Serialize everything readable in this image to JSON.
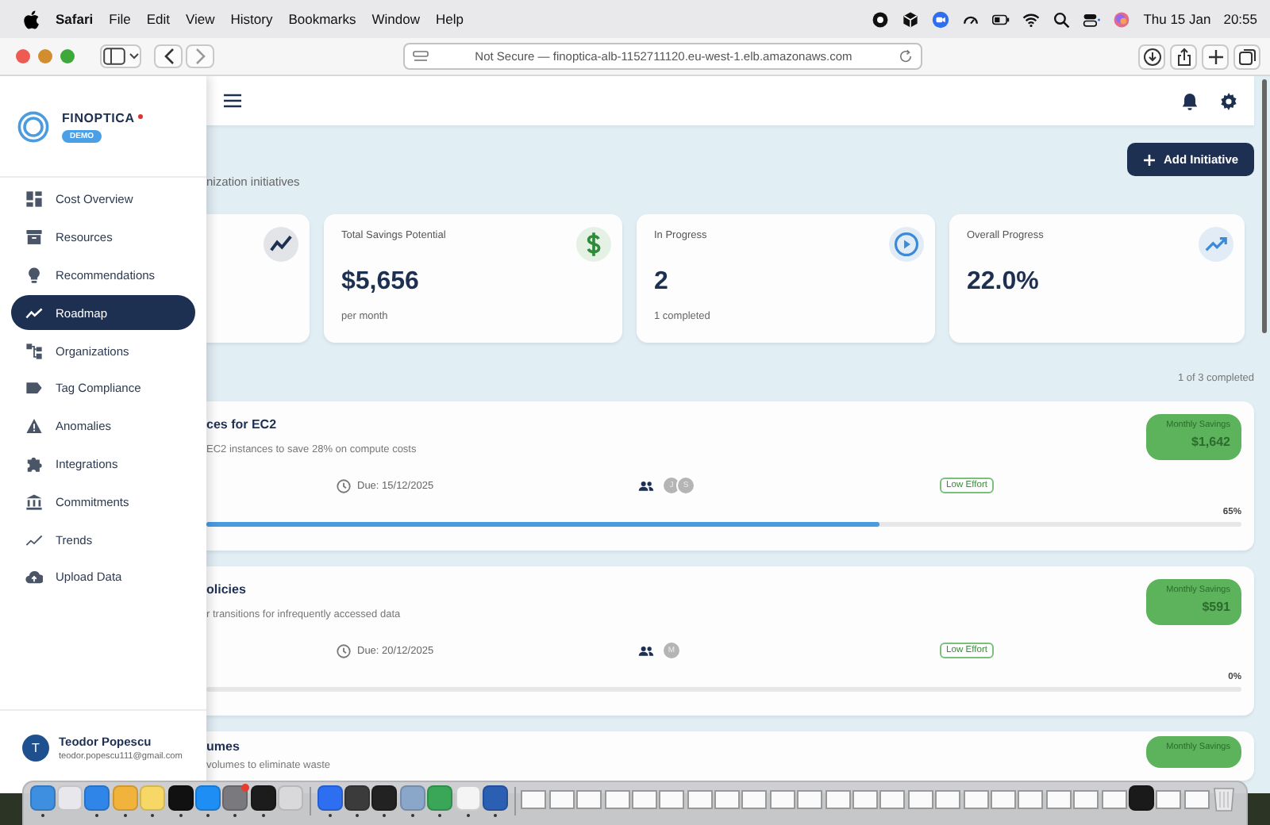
{
  "menu_bar": {
    "app": "Safari",
    "menus": [
      "File",
      "Edit",
      "View",
      "History",
      "Bookmarks",
      "Window",
      "Help"
    ],
    "date": "Thu 15 Jan",
    "time": "20:55"
  },
  "browser": {
    "address": "Not Secure — finoptica-alb-1152711120.eu-west-1.elb.amazonaws.com"
  },
  "sidebar": {
    "brand": "FINOPTICA",
    "badge": "DEMO",
    "items": [
      {
        "label": "Cost Overview",
        "selected": false
      },
      {
        "label": "Resources",
        "selected": false
      },
      {
        "label": "Recommendations",
        "selected": false
      },
      {
        "label": "Roadmap",
        "selected": true
      },
      {
        "label": "Organizations",
        "selected": false
      },
      {
        "label": "Tag Compliance",
        "selected": false
      },
      {
        "label": "Anomalies",
        "selected": false
      },
      {
        "label": "Integrations",
        "selected": false
      },
      {
        "label": "Commitments",
        "selected": false
      },
      {
        "label": "Trends",
        "selected": false
      },
      {
        "label": "Upload Data",
        "selected": false
      }
    ],
    "user": {
      "initial": "T",
      "name": "Teodor Popescu",
      "email": "teodor.popescu111@gmail.com"
    }
  },
  "header": {
    "subtitle": "nization initiatives",
    "button": "Add Initiative"
  },
  "stats": [
    {
      "kind": "trend"
    },
    {
      "kind": "savings",
      "label": "Total Savings Potential",
      "value": "$5,656",
      "note": "per month"
    },
    {
      "kind": "progress",
      "label": "In Progress",
      "value": "2",
      "note": "1 completed"
    },
    {
      "kind": "overall",
      "label": "Overall Progress",
      "value": "22.0%"
    }
  ],
  "summary": "1 of 3 completed",
  "initiatives": [
    {
      "title": "ces for EC2",
      "description": "EC2 instances to save 28% on compute costs",
      "due": "Due: 15/12/2025",
      "owners": [
        "J",
        "S"
      ],
      "effort": "Low Effort",
      "savings_label": "Monthly Savings",
      "savings": "$1,642",
      "percent": "65%",
      "level": 0.65
    },
    {
      "title": "olicies",
      "description": "r transitions for infrequently accessed data",
      "due": "Due: 20/12/2025",
      "owners": [
        "M"
      ],
      "effort": "Low Effort",
      "savings_label": "Monthly Savings",
      "savings": "$591",
      "percent": "0%",
      "level": 0
    },
    {
      "title": "umes",
      "description": "volumes to eliminate waste",
      "savings_label": "Monthly Savings"
    }
  ],
  "dock": [
    {
      "kind": "app",
      "color": "#3f8fe0",
      "running": true
    },
    {
      "kind": "app",
      "color": "#e8e8ec",
      "running": false
    },
    {
      "kind": "app",
      "color": "#2f86e8",
      "running": true
    },
    {
      "kind": "app",
      "color": "#f2b33d",
      "running": true
    },
    {
      "kind": "app",
      "color": "#f7d766",
      "running": true
    },
    {
      "kind": "app",
      "color": "#111111",
      "running": true
    },
    {
      "kind": "app",
      "color": "#1e8ef5",
      "running": true
    },
    {
      "kind": "app",
      "color": "#7a7a7e",
      "running": true,
      "badge": true
    },
    {
      "kind": "app",
      "color": "#1c1c1c",
      "running": true
    },
    {
      "kind": "app",
      "color": "#d9d9dc",
      "running": false
    },
    {
      "kind": "separator"
    },
    {
      "kind": "app",
      "color": "#2d6ff0",
      "running": true
    },
    {
      "kind": "app",
      "color": "#3b3b3b",
      "running": true
    },
    {
      "kind": "app",
      "color": "#222222",
      "running": true
    },
    {
      "kind": "app",
      "color": "#8aa6c8",
      "running": true
    },
    {
      "kind": "app",
      "color": "#3aa657",
      "running": true
    },
    {
      "kind": "app",
      "color": "#f4f4f4",
      "running": true
    },
    {
      "kind": "app",
      "color": "#2b5fb4",
      "running": true
    },
    {
      "kind": "separator"
    },
    {
      "kind": "window"
    },
    {
      "kind": "window"
    },
    {
      "kind": "window"
    },
    {
      "kind": "window"
    },
    {
      "kind": "window"
    },
    {
      "kind": "window"
    },
    {
      "kind": "window"
    },
    {
      "kind": "window"
    },
    {
      "kind": "window"
    },
    {
      "kind": "window"
    },
    {
      "kind": "window"
    },
    {
      "kind": "window"
    },
    {
      "kind": "window"
    },
    {
      "kind": "window"
    },
    {
      "kind": "window"
    },
    {
      "kind": "window"
    },
    {
      "kind": "window"
    },
    {
      "kind": "window"
    },
    {
      "kind": "window"
    },
    {
      "kind": "window"
    },
    {
      "kind": "window"
    },
    {
      "kind": "window"
    },
    {
      "kind": "app",
      "color": "#1a1a1a",
      "running": false
    },
    {
      "kind": "window"
    },
    {
      "kind": "window"
    },
    {
      "kind": "trash"
    }
  ]
}
